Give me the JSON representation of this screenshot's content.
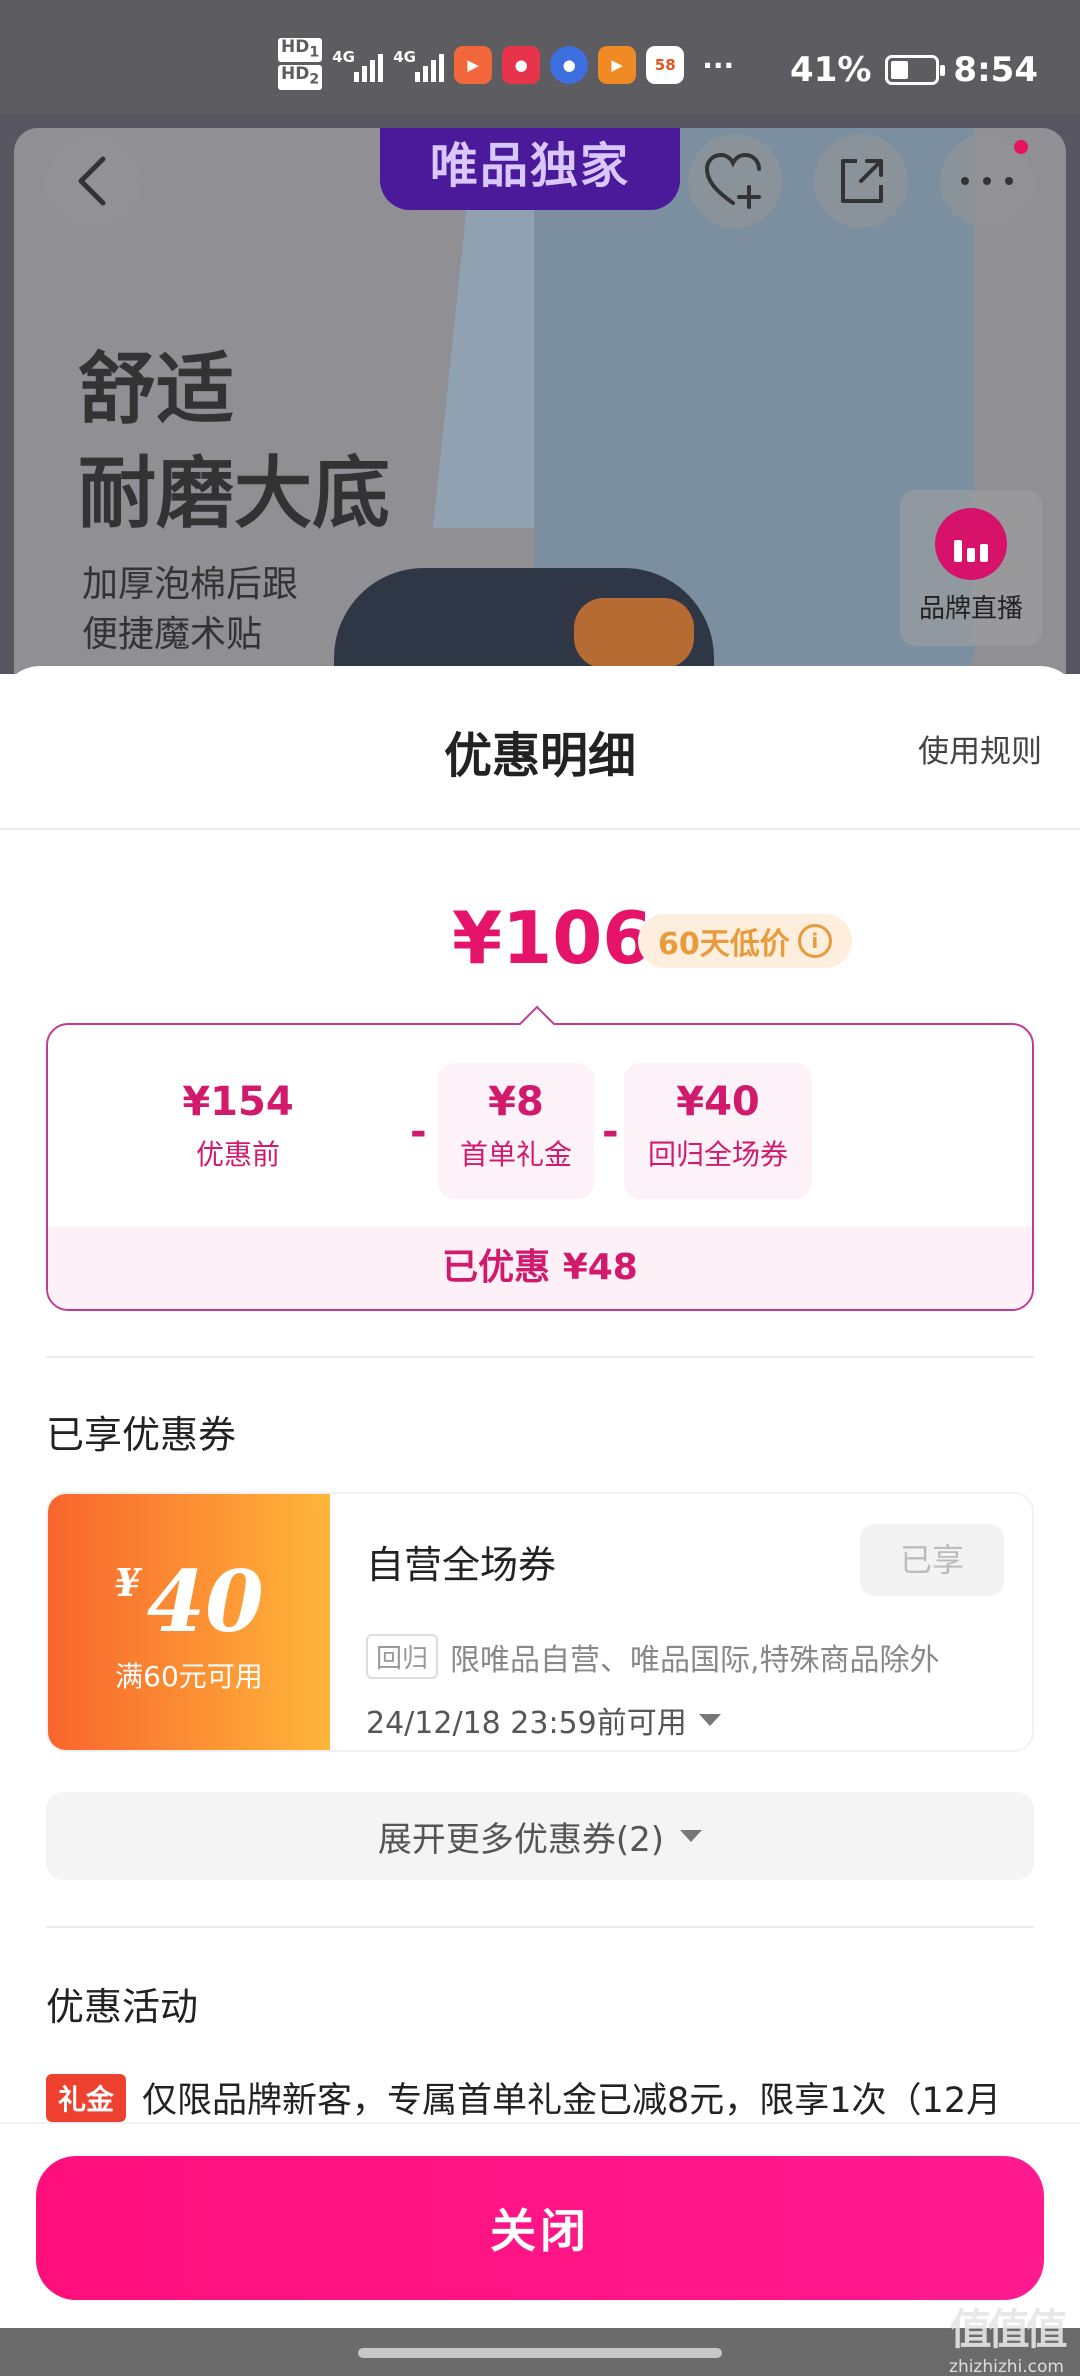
{
  "status_bar": {
    "hd1": "HD",
    "hd1_sub": "1",
    "hd2": "HD",
    "hd2_sub": "2",
    "net1": "4G",
    "net2": "4G",
    "app_icons": [
      {
        "name": "bilibili-app-icon",
        "color": "#f2683c"
      },
      {
        "name": "pig-app-icon",
        "color": "#e8344a"
      },
      {
        "name": "blue-ball-app-icon",
        "color": "#3d6fe0"
      },
      {
        "name": "play-app-icon",
        "color": "#f08a24"
      },
      {
        "name": "58-app-icon",
        "color": "#ffffff",
        "label": "58"
      }
    ],
    "more": "···",
    "battery": "41%",
    "battery_level": 0.41,
    "time": "8:54"
  },
  "hero": {
    "banner": "唯品独家",
    "title_line1": "舒适",
    "title_line2": "耐磨大底",
    "sub_line1": "加厚泡棉后跟",
    "sub_line2": "便捷魔术贴",
    "live_label": "品牌直播"
  },
  "sheet": {
    "title": "优惠明细",
    "rules_link": "使用规则",
    "final_price": "¥106",
    "lowest_tag": "60天低价",
    "breakdown": {
      "items": [
        {
          "value": "¥154",
          "label": "优惠前"
        },
        {
          "value": "¥8",
          "label": "首单礼金"
        },
        {
          "value": "¥40",
          "label": "回归全场券"
        }
      ],
      "minus": "-",
      "saved": "已优惠 ¥48"
    },
    "coupons_title": "已享优惠券",
    "coupon": {
      "currency": "¥",
      "amount": "40",
      "condition": "满60元可用",
      "name": "自营全场券",
      "status": "已享",
      "tag": "回归",
      "desc": "限唯品自营、唯品国际,特殊商品除外",
      "expire": "24/12/18 23:59前可用"
    },
    "expand_label": "展开更多优惠券(2)",
    "activities_title": "优惠活动",
    "promo_tag": "礼金",
    "promo_text": "仅限品牌新客，专属首单礼金已减8元，限享1次（12月",
    "close_label": "关闭"
  },
  "watermark": {
    "logo": "值值值",
    "site": "zhizhizhi.com"
  },
  "colors": {
    "accent": "#e5136a",
    "close_button": "#ff0f7b",
    "coupon_gradient_start": "#f9652d",
    "coupon_gradient_end": "#ffb63a",
    "banner": "#4b1a9a"
  }
}
